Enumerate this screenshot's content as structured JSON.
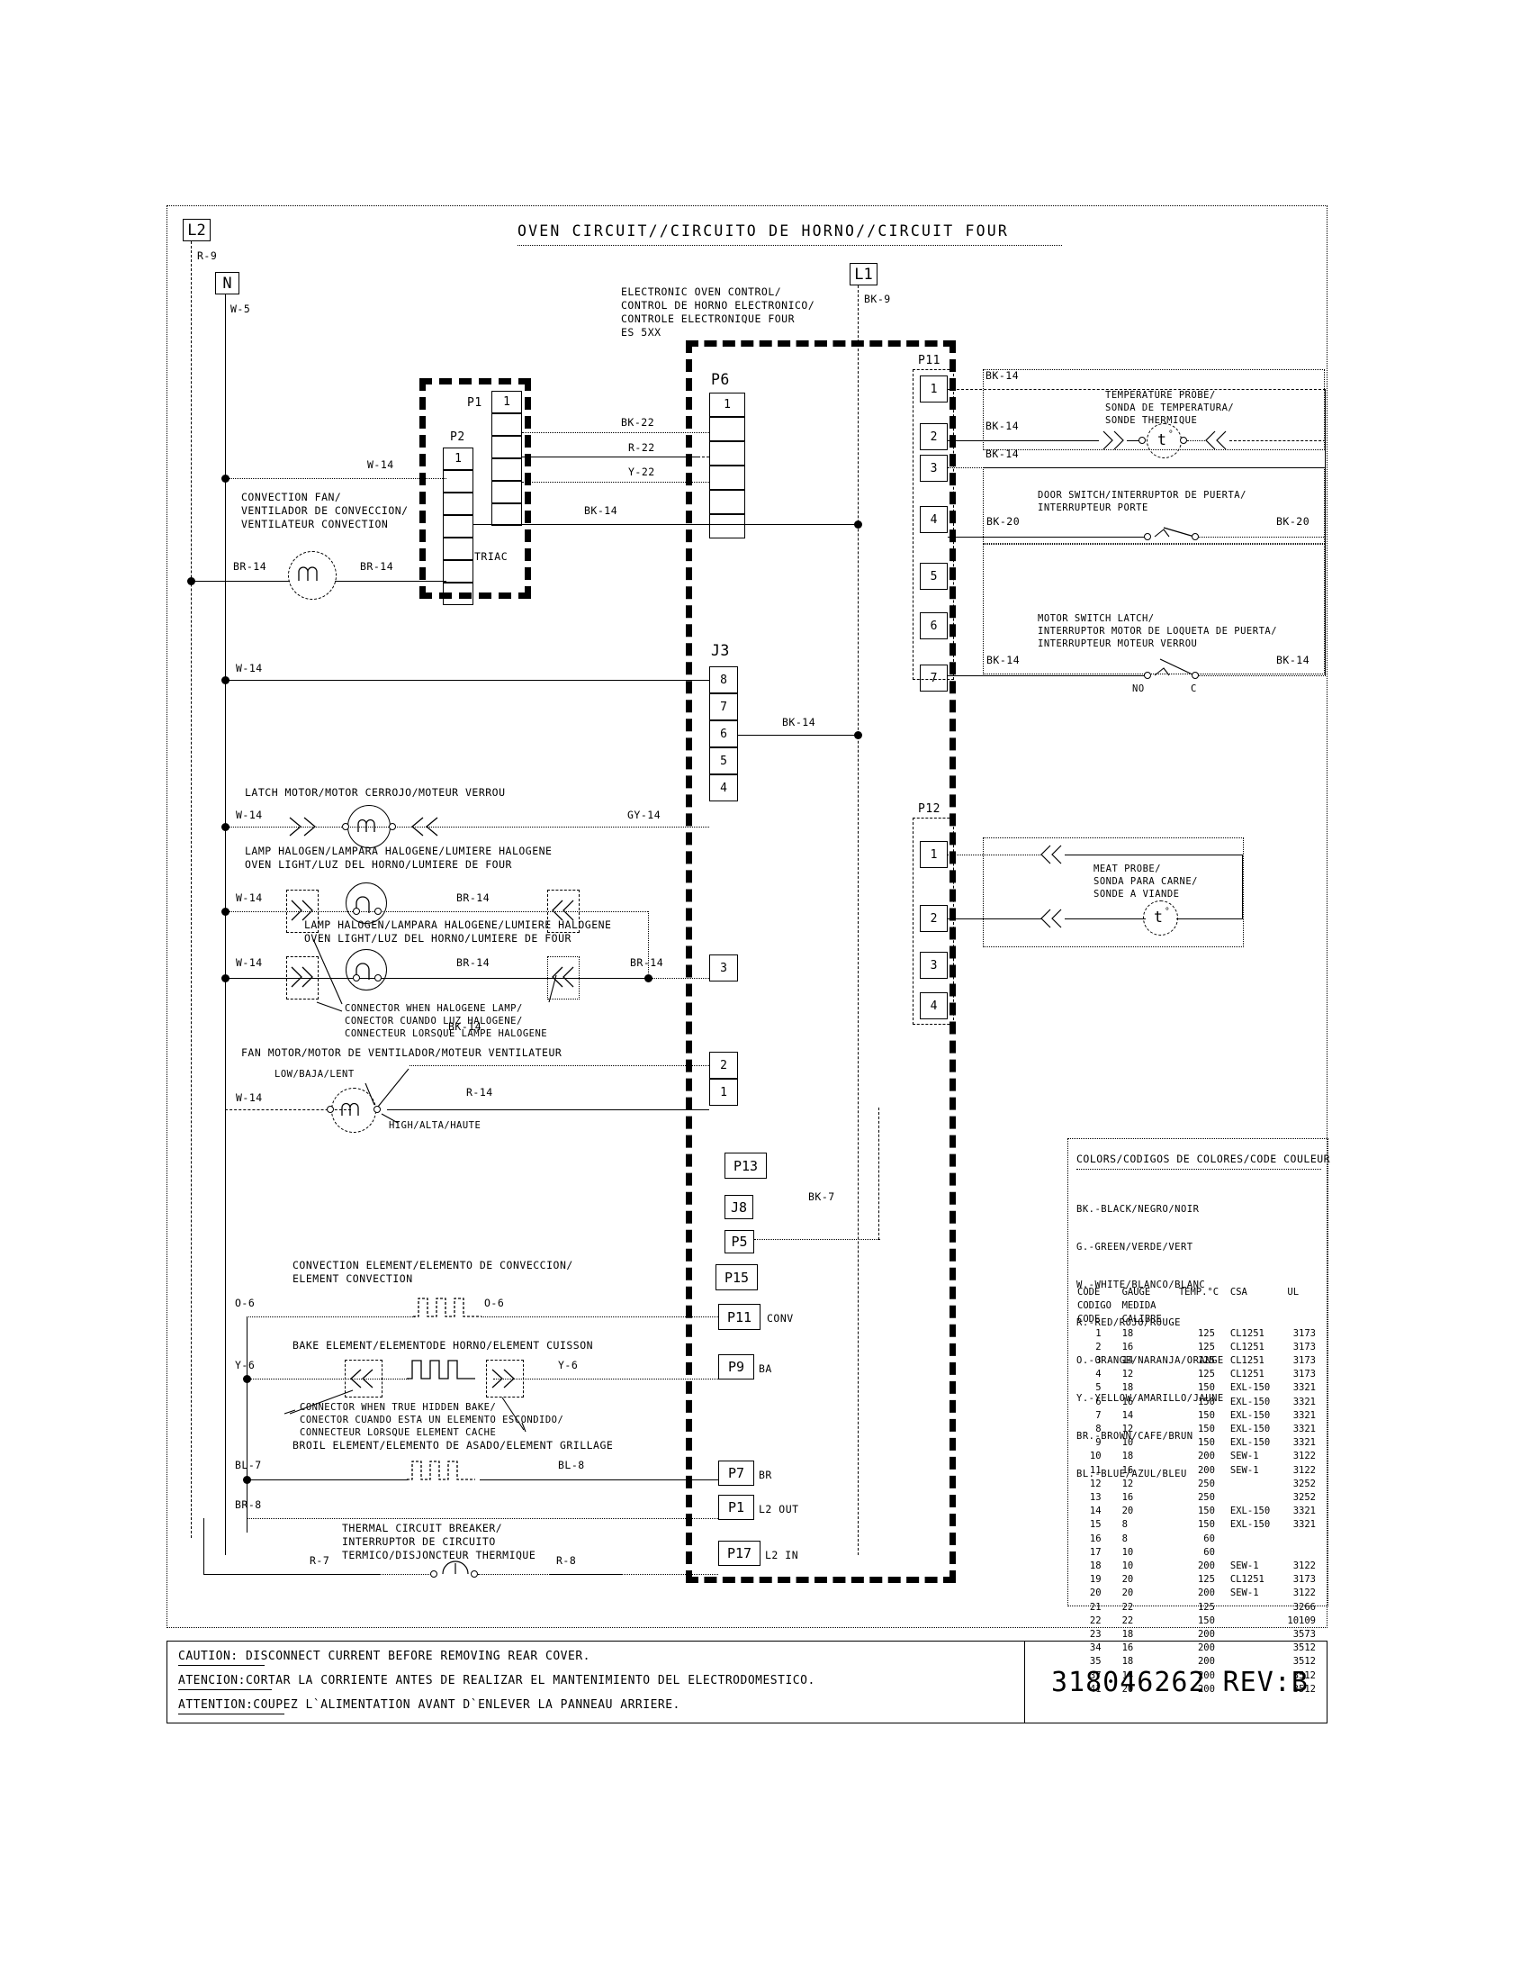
{
  "title": "OVEN CIRCUIT//CIRCUITO DE HORNO//CIRCUIT FOUR",
  "terminals": {
    "l2": "L2",
    "n": "N",
    "l1": "L1"
  },
  "wire_tags": {
    "l2_r9": "R-9",
    "n_w5": "W-5",
    "l1_bk9": "BK-9",
    "conv_w14": "W-14",
    "conv_br14_left": "BR-14",
    "conv_br14_right": "BR-14",
    "bk22": "BK-22",
    "r22": "R-22",
    "y22": "Y-22",
    "bk14_triac": "BK-14",
    "bk14_j3_6": "BK-14",
    "w14_j3_8": "W-14",
    "latch_w14": "W-14",
    "latch_gy14": "GY-14",
    "lamp1_w14": "W-14",
    "lamp1_br14": "BR-14",
    "lamp2_w14": "W-14",
    "lamp2_br14": "BR-14",
    "lamp2_br14_right": "BR-14",
    "fan_bk14": "BK-14",
    "fan_w14": "W-14",
    "fan_r14": "R-14",
    "bk7": "BK-7",
    "conv_o6_left": "O-6",
    "conv_o6_right": "O-6",
    "bake_y6_left": "Y-6",
    "bake_y6_right": "Y-6",
    "broil_bl7": "BL-7",
    "broil_bl8": "BL-8",
    "br8": "BR-8",
    "tcb_r7": "R-7",
    "tcb_r8": "R-8",
    "p11_1_bk14": "BK-14",
    "p11_2_bk14": "BK-14",
    "p11_3_bk14": "BK-14",
    "door_bk20_left": "BK-20",
    "door_bk20_right": "BK-20",
    "latchsw_bk14_left": "BK-14",
    "latchsw_bk14_right": "BK-14"
  },
  "control": {
    "label": "ELECTRONIC OVEN CONTROL/\nCONTROL DE HORNO ELECTRONICO/\nCONTROLE ELECTRONIQUE FOUR\nES 5XX"
  },
  "components": {
    "convection_fan": "CONVECTION FAN/\nVENTILADOR DE CONVECCION/\nVENTILATEUR CONVECTION",
    "triac": "TRIAC",
    "latch_motor": "LATCH MOTOR/MOTOR CERROJO/MOTEUR VERROU",
    "lamp_halogen_1": "LAMP HALOGEN/LAMPARA HALOGENE/LUMIERE HALOGENE\nOVEN LIGHT/LUZ DEL HORNO/LUMIERE DE FOUR",
    "lamp_halogen_2": "LAMP HALOGEN/LAMPARA HALOGENE/LUMIERE HALOGENE\nOVEN LIGHT/LUZ DEL HORNO/LUMIERE DE FOUR",
    "connector_halogene": "CONNECTOR WHEN HALOGENE LAMP/\nCONECTOR CUANDO LUZ HALOGENE/\nCONNECTEUR LORSQUE LAMPE HALOGENE",
    "fan_motor": "FAN MOTOR/MOTOR DE VENTILADOR/MOTEUR VENTILATEUR",
    "fan_low": "LOW/BAJA/LENT",
    "fan_high": "HIGH/ALTA/HAUTE",
    "convection_element": "CONVECTION ELEMENT/ELEMENTO DE CONVECCION/\nELEMENT CONVECTION",
    "bake_element": "BAKE ELEMENT/ELEMENTODE HORNO/ELEMENT CUISSON",
    "connector_hidden_bake": "CONNECTOR WHEN TRUE HIDDEN BAKE/\nCONECTOR CUANDO ESTA UN ELEMENTO ESCONDIDO/\nCONNECTEUR LORSQUE ELEMENT CACHE",
    "broil_element": "BROIL ELEMENT/ELEMENTO DE ASADO/ELEMENT GRILLAGE",
    "thermal_breaker": "THERMAL CIRCUIT BREAKER/\nINTERRUPTOR DE CIRCUITO\nTERMICO/DISJONCTEUR THERMIQUE",
    "temperature_probe": "TEMPERATURE PROBE/\nSONDA DE TEMPERATURA/\nSONDE THERMIQUE",
    "door_switch": "DOOR SWITCH/INTERRUPTOR DE PUERTA/\nINTERRUPTEUR PORTE",
    "motor_switch_latch": "MOTOR SWITCH LATCH/\nINTERRUPTOR MOTOR DE LOQUETA DE PUERTA/\nINTERRUPTEUR MOTEUR VERROU",
    "latch_no": "NO",
    "latch_c": "C",
    "meat_probe": "MEAT PROBE/\nSONDA PARA CARNE/\nSONDE A VIANDE",
    "probe_glyph": "t"
  },
  "connectors": {
    "p1": {
      "label": "P1",
      "pins": [
        "1",
        "",
        "",
        "",
        "",
        ""
      ]
    },
    "p2": {
      "label": "P2",
      "pins": [
        "1",
        "",
        "",
        "",
        "",
        "",
        ""
      ]
    },
    "p6": {
      "label": "P6",
      "pins": [
        "1",
        "",
        "",
        "",
        "",
        ""
      ]
    },
    "j3": {
      "label": "J3",
      "pins": [
        "8",
        "7",
        "6",
        "5",
        "4"
      ],
      "pins_lower": [
        "3"
      ],
      "pins_bottom": [
        "2",
        "1"
      ]
    },
    "p11_right": {
      "label": "P11",
      "pins": [
        "1",
        "2",
        "3",
        "4",
        "5",
        "6",
        "7"
      ]
    },
    "p12_right": {
      "label": "P12",
      "pins": [
        "1",
        "2",
        "3",
        "4"
      ]
    },
    "stack": [
      {
        "label": "P13",
        "tag": ""
      },
      {
        "label": "J8",
        "tag": ""
      },
      {
        "label": "P5",
        "tag": ""
      },
      {
        "label": "P15",
        "tag": ""
      },
      {
        "label": "P11",
        "tag": "CONV"
      },
      {
        "label": "P9",
        "tag": "BA"
      },
      {
        "label": "P7",
        "tag": "BR"
      },
      {
        "label": "P1",
        "tag": "L2 OUT"
      },
      {
        "label": "P17",
        "tag": "L2 IN"
      }
    ]
  },
  "legend": {
    "title": "COLORS/CODIGOS DE COLORES/CODE COULEUR",
    "colors": [
      "BK.-BLACK/NEGRO/NOIR",
      "G.-GREEN/VERDE/VERT",
      "W.-WHITE/BLANCO/BLANC",
      "R.-RED/ROJO/ROUGE",
      "O.-ORANGE/NARANJA/ORANGE",
      "Y.-YELLOW/AMARILLO/JAUNE",
      "BR.-BROWN/CAFE/BRUN",
      "BL.-BLUE/AZUL/BLEU"
    ],
    "table_headers": [
      "CODE",
      "GAUGE",
      "TEMP.°C",
      "CSA",
      "UL"
    ],
    "table_subheaders_1": [
      "CODIGO",
      "MEDIDA"
    ],
    "table_subheaders_2": [
      "CODE",
      "CALIBRE"
    ],
    "rows": [
      [
        "1",
        "18",
        "125",
        "CL1251",
        "3173"
      ],
      [
        "2",
        "16",
        "125",
        "CL1251",
        "3173"
      ],
      [
        "3",
        "14",
        "125",
        "CL1251",
        "3173"
      ],
      [
        "4",
        "12",
        "125",
        "CL1251",
        "3173"
      ],
      [
        "5",
        "18",
        "150",
        "EXL-150",
        "3321"
      ],
      [
        "6",
        "16",
        "150",
        "EXL-150",
        "3321"
      ],
      [
        "7",
        "14",
        "150",
        "EXL-150",
        "3321"
      ],
      [
        "8",
        "12",
        "150",
        "EXL-150",
        "3321"
      ],
      [
        "9",
        "10",
        "150",
        "EXL-150",
        "3321"
      ],
      [
        "10",
        "18",
        "200",
        "SEW-1",
        "3122"
      ],
      [
        "11",
        "16",
        "200",
        "SEW-1",
        "3122"
      ],
      [
        "12",
        "12",
        "250",
        "",
        "3252"
      ],
      [
        "13",
        "16",
        "250",
        "",
        "3252"
      ],
      [
        "14",
        "20",
        "150",
        "EXL-150",
        "3321"
      ],
      [
        "15",
        "8",
        "150",
        "EXL-150",
        "3321"
      ],
      [
        "16",
        "8",
        "60",
        "",
        ""
      ],
      [
        "17",
        "10",
        "60",
        "",
        ""
      ],
      [
        "18",
        "10",
        "200",
        "SEW-1",
        "3122"
      ],
      [
        "19",
        "20",
        "125",
        "CL1251",
        "3173"
      ],
      [
        "20",
        "20",
        "200",
        "SEW-1",
        "3122"
      ],
      [
        "21",
        "22",
        "125",
        "",
        "3266"
      ],
      [
        "22",
        "22",
        "150",
        "",
        "10109"
      ],
      [
        "23",
        "18",
        "200",
        "",
        "3573"
      ],
      [
        "34",
        "16",
        "200",
        "",
        "3512"
      ],
      [
        "35",
        "18",
        "200",
        "",
        "3512"
      ],
      [
        "37",
        "14",
        "200",
        "",
        "3512"
      ],
      [
        "41",
        "20",
        "200",
        "",
        "3512"
      ]
    ]
  },
  "footer": {
    "caution_en": "CAUTION: DISCONNECT CURRENT BEFORE REMOVING REAR COVER.",
    "caution_es": "ATENCION:CORTAR LA CORRIENTE ANTES DE REALIZAR EL MANTENIMIENTO DEL ELECTRODOMESTICO.",
    "caution_fr": "ATTENTION:COUPEZ L`ALIMENTATION AVANT D`ENLEVER LA PANNEAU ARRIERE.",
    "part_number": "318046262 REV:B"
  }
}
